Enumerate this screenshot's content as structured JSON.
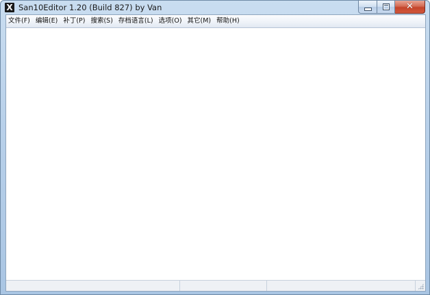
{
  "window": {
    "title": "San10Editor 1.20 (Build 827) by Van",
    "icon": "app-x-icon",
    "icon_glyph": "X",
    "caption": {
      "minimize_icon": "minimize-icon",
      "maximize_icon": "maximize-icon",
      "close_icon": "close-icon",
      "close_glyph": "✕"
    }
  },
  "menu": {
    "items": [
      {
        "label": "文件(F)"
      },
      {
        "label": "编辑(E)"
      },
      {
        "label": "补丁(P)"
      },
      {
        "label": "搜索(S)"
      },
      {
        "label": "存档语言(L)"
      },
      {
        "label": "选项(O)"
      },
      {
        "label": "其它(M)"
      },
      {
        "label": "帮助(H)"
      }
    ]
  },
  "colors": {
    "frame": "#b9d1ea",
    "close_button": "#c4452b",
    "client_bg": "#ffffff"
  }
}
